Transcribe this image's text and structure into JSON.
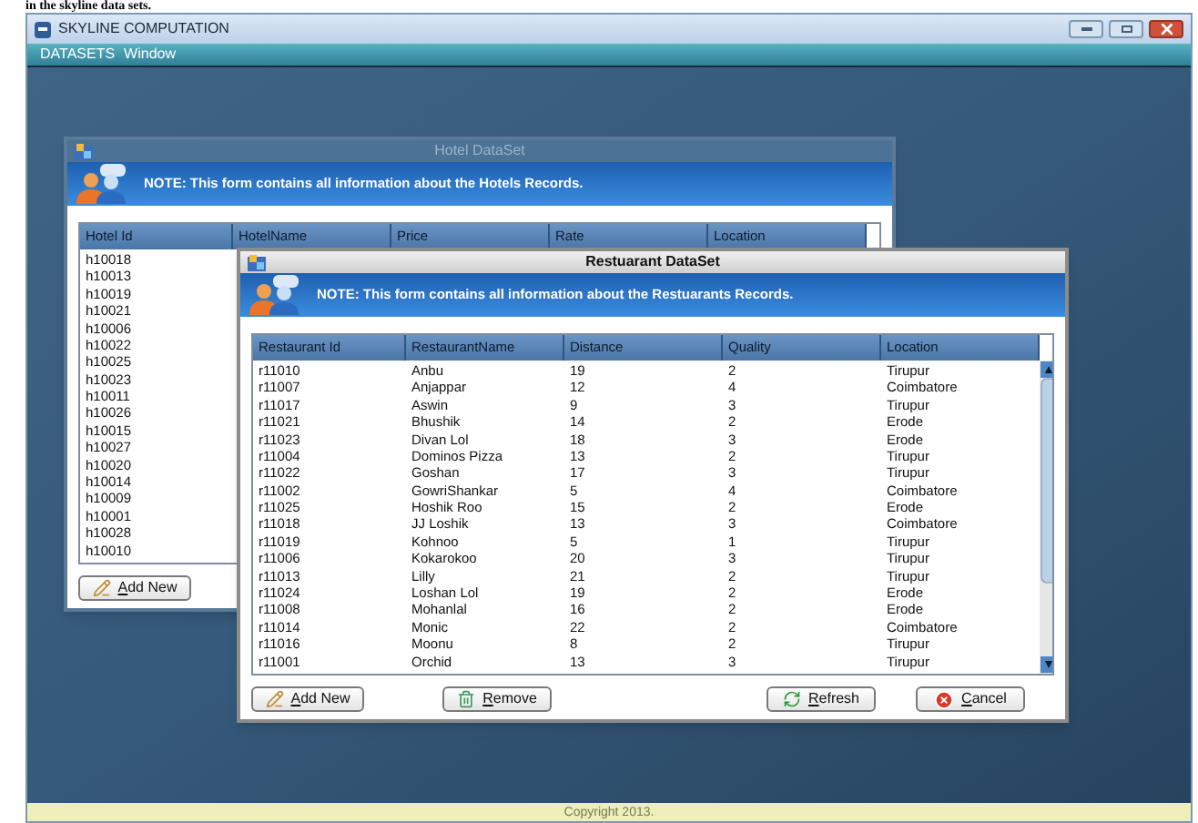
{
  "caption": "in the skyline data sets.",
  "window": {
    "title": "SKYLINE COMPUTATION",
    "menu": [
      "DATASETS",
      "Window"
    ]
  },
  "frames": [
    {
      "title": "Hotel DataSet",
      "active": false,
      "note": "NOTE: This form contains all information about the Hotels Records.",
      "columns": [
        "Hotel Id",
        "HotelName",
        "Price",
        "Rate",
        "Location"
      ],
      "rows": [
        [
          "h10018"
        ],
        [
          "h10013"
        ],
        [
          "h10019"
        ],
        [
          "h10021"
        ],
        [
          "h10006"
        ],
        [
          "h10022"
        ],
        [
          "h10025"
        ],
        [
          "h10023"
        ],
        [
          "h10011"
        ],
        [
          "h10026"
        ],
        [
          "h10015"
        ],
        [
          "h10027"
        ],
        [
          "h10020"
        ],
        [
          "h10014"
        ],
        [
          "h10009"
        ],
        [
          "h10001"
        ],
        [
          "h10028"
        ],
        [
          "h10010"
        ]
      ],
      "buttons": [
        {
          "label": "Add New",
          "kind": "add"
        }
      ]
    },
    {
      "title": "Restuarant DataSet",
      "active": true,
      "note": "NOTE: This form contains all information about the Restuarants Records.",
      "columns": [
        "Restaurant Id",
        "RestaurantName",
        "Distance",
        "Quality",
        "Location"
      ],
      "rows": [
        [
          "r11010",
          "Anbu",
          "19",
          "2",
          "Tirupur"
        ],
        [
          "r11007",
          "Anjappar",
          "12",
          "4",
          "Coimbatore"
        ],
        [
          "r11017",
          "Aswin",
          "9",
          "3",
          "Tirupur"
        ],
        [
          "r11021",
          "Bhushik",
          "14",
          "2",
          "Erode"
        ],
        [
          "r11023",
          "Divan Lol",
          "18",
          "3",
          "Erode"
        ],
        [
          "r11004",
          "Dominos Pizza",
          "13",
          "2",
          "Tirupur"
        ],
        [
          "r11022",
          "Goshan",
          "17",
          "3",
          "Tirupur"
        ],
        [
          "r11002",
          "GowriShankar",
          "5",
          "4",
          "Coimbatore"
        ],
        [
          "r11025",
          "Hoshik Roo",
          "15",
          "2",
          "Erode"
        ],
        [
          "r11018",
          "JJ Loshik",
          "13",
          "3",
          "Coimbatore"
        ],
        [
          "r11019",
          "Kohnoo",
          "5",
          "1",
          "Tirupur"
        ],
        [
          "r11006",
          "Kokarokoo",
          "20",
          "3",
          "Tirupur"
        ],
        [
          "r11013",
          "Lilly",
          "21",
          "2",
          "Tirupur"
        ],
        [
          "r11024",
          "Loshan Lol",
          "19",
          "2",
          "Erode"
        ],
        [
          "r11008",
          "Mohanlal",
          "16",
          "2",
          "Erode"
        ],
        [
          "r11014",
          "Monic",
          "22",
          "2",
          "Coimbatore"
        ],
        [
          "r11016",
          "Moonu",
          "8",
          "2",
          "Tirupur"
        ],
        [
          "r11001",
          "Orchid",
          "13",
          "3",
          "Tirupur"
        ]
      ],
      "buttons": [
        {
          "label": "Add New",
          "kind": "add"
        },
        {
          "label": "Remove",
          "kind": "remove"
        },
        {
          "label": "Refresh",
          "kind": "refresh"
        },
        {
          "label": "Cancel",
          "kind": "cancel"
        }
      ]
    }
  ],
  "status_bar": "Copyright 2013."
}
